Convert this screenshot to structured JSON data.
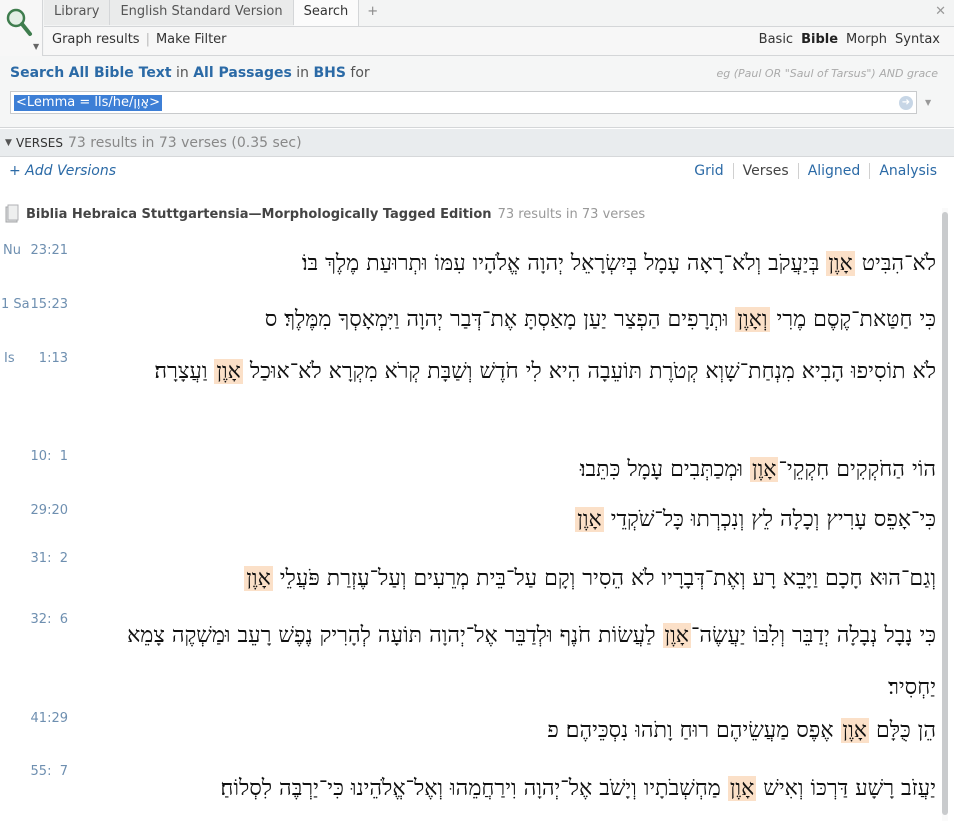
{
  "tabs": [
    "Library",
    "English Standard Version",
    "Search",
    "+"
  ],
  "toolbar": {
    "graph": "Graph results",
    "filter": "Make Filter",
    "modes": [
      "Basic",
      "Bible",
      "Morph",
      "Syntax"
    ],
    "active_mode": "Bible"
  },
  "search": {
    "scope_prefix": "Search",
    "scope_what": "All Bible Text",
    "in1": "in",
    "scope_where": "All Passages",
    "in2": "in",
    "scope_version": "BHS",
    "for": "for",
    "hint": "eg (Paul OR \"Saul of Tarsus\") AND grace",
    "query": "<Lemma = lls/he/אָוֶן>"
  },
  "results": {
    "label": "VERSES",
    "summary": "73 results in 73 verses (0.35 sec)"
  },
  "add_versions": "+ Add Versions",
  "views": [
    "Grid",
    "Verses",
    "Aligned",
    "Analysis"
  ],
  "active_view": "Verses",
  "book": {
    "name": "Biblia Hebraica Stuttgartensia—Morphologically Tagged Edition",
    "count": "73 results in 73 verses"
  },
  "verses": [
    {
      "book": "Nu",
      "ref": "23:21",
      "pre": "לֹא־הִבִּיט ",
      "hit": "אָוֶן",
      "post": " בְּיַעֲקֹב וְלֹא־רָאָה עָמָל בְּיִשְׂרָאֵל יְהוָה אֱלֹהָיו עִמּוֹ וּתְרוּעַת מֶלֶךְ בּוֹ׃"
    },
    {
      "book": "1 Sa",
      "ref": "15:23",
      "pre": "כִּי חַטַּאת־קֶסֶם מֶרִי ",
      "hit": "וְאָוֶן",
      "post": " וּתְרָפִים הַפְצַר יַעַן מָאַסְתָּ אֶת־דְּבַר יְהוָה וַיִּמְאָסְךָ מִמֶּלֶךְ׃ ס"
    },
    {
      "book": "Is",
      "ref": "1:13",
      "pre": "לֹא תוֹסִיפוּ הָבִיא מִנְחַת־שָׁוְא קְטֹרֶת תּוֹעֵבָה הִיא לִי חֹדֶשׁ וְשַׁבָּת קְרֹא מִקְרָא לֹא־אוּכַל ",
      "hit": "אָוֶן",
      "post": " וַעֲצָרָה׃"
    },
    {
      "book": "",
      "ref": "10:  1",
      "pre": "הוֹי הַחֹקְקִים חִקְקֵי־",
      "hit": "אָוֶן",
      "post": " וּמְכַתְּבִים עָמָל כִּתֵּבוּ׃"
    },
    {
      "book": "",
      "ref": "29:20",
      "pre": "כִּי־אָפֵס עָרִיץ וְכָלָה לֵץ וְנִכְרְתוּ כָּל־שֹׁקְדֵי ",
      "hit": "אָוֶן",
      "post": "׃"
    },
    {
      "book": "",
      "ref": "31:  2",
      "pre": "וְגַם־הוּא חָכָם וַיָּבֵא רָע וְאֶת־דְּבָרָיו לֹא הֵסִיר וְקָם עַל־בֵּית מְרֵעִים וְעַל־עֶזְרַת פֹּעֲלֵי ",
      "hit": "אָוֶן",
      "post": "׃"
    },
    {
      "book": "",
      "ref": "32:  6",
      "pre": "כִּי נָבָל נְבָלָה יְדַבֵּר וְלִבּוֹ יַעֲשֶׂה־",
      "hit": "אָוֶן",
      "post": " לַעֲשׂוֹת חֹנֶף וּלְדַבֵּר אֶל־יְהוָה תּוֹעָה לְהָרִיק נֶפֶשׁ רָעֵב וּמַשְׁקֶה צָמֵא יַחְסִיר׃"
    },
    {
      "book": "",
      "ref": "41:29",
      "pre": "הֵן כֻּלָּם ",
      "hit": "אָוֶן",
      "post": " אֶפֶס מַעֲשֵׂיהֶם רוּחַ וָתֹהוּ נִסְכֵּיהֶם׃ פ"
    },
    {
      "book": "",
      "ref": "55:  7",
      "pre": "יַעֲזֹב רָשָׁע דַּרְכּוֹ וְאִישׁ ",
      "hit": "אָוֶן",
      "post": " מַחְשְׁבֹתָיו וְיָשֹׁב אֶל־יְהוָה וִירַחֲמֵהוּ וְאֶל־אֱלֹהֵינוּ כִּי־יַרְבֶּה לִסְלוֹחַ׃"
    }
  ]
}
